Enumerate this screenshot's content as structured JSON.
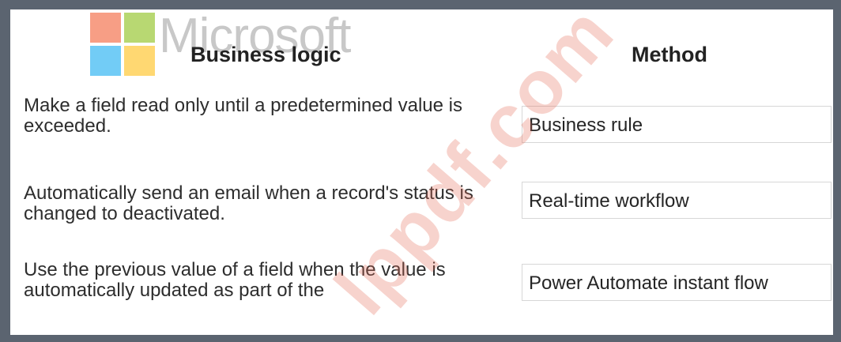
{
  "logo": {
    "text": "Microsoft"
  },
  "table": {
    "headers": {
      "business_logic": "Business logic",
      "method": "Method"
    },
    "rows": [
      {
        "logic": "Make a field read only until a predetermined value is exceeded.",
        "method": "Business rule"
      },
      {
        "logic": "Automatically send an email when a record's status is changed to deactivated.",
        "method": "Real-time workflow"
      },
      {
        "logic": "Use the previous value of a field when the value is automatically updated as part of the",
        "method": "Power Automate instant flow"
      }
    ]
  },
  "watermark": {
    "text": "lppdf.com"
  }
}
